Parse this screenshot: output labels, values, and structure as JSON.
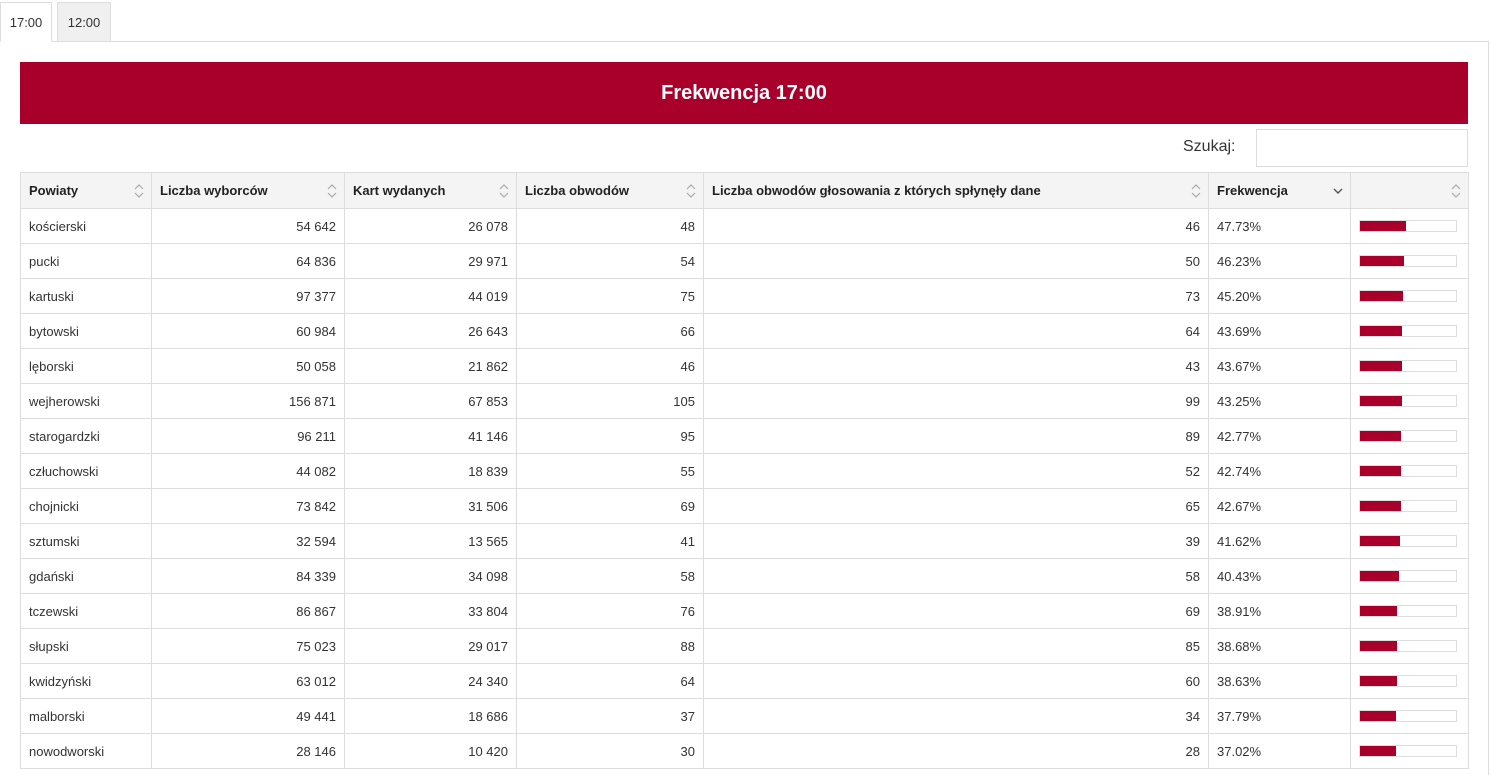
{
  "tabs": [
    {
      "label": "17:00",
      "active": true
    },
    {
      "label": "12:00",
      "active": false
    }
  ],
  "banner": {
    "title": "Frekwencja 17:00"
  },
  "search": {
    "label": "Szukaj:",
    "value": ""
  },
  "colors": {
    "accent": "#a8002b",
    "header_bg": "#f4f4f4",
    "border": "#dddddd"
  },
  "table": {
    "columns": [
      "Powiaty",
      "Liczba wyborców",
      "Kart wydanych",
      "Liczba obwodów",
      "Liczba obwodów głosowania z których spłynęły dane",
      "Frekwencja",
      ""
    ],
    "sorted_column": 5,
    "sort_direction": "desc",
    "rows": [
      {
        "name": "kościerski",
        "voters": "54 642",
        "cards": "26 078",
        "districts": "48",
        "reported": "46",
        "turnout": "47.73%",
        "turnout_pct": 47.73
      },
      {
        "name": "pucki",
        "voters": "64 836",
        "cards": "29 971",
        "districts": "54",
        "reported": "50",
        "turnout": "46.23%",
        "turnout_pct": 46.23
      },
      {
        "name": "kartuski",
        "voters": "97 377",
        "cards": "44 019",
        "districts": "75",
        "reported": "73",
        "turnout": "45.20%",
        "turnout_pct": 45.2
      },
      {
        "name": "bytowski",
        "voters": "60 984",
        "cards": "26 643",
        "districts": "66",
        "reported": "64",
        "turnout": "43.69%",
        "turnout_pct": 43.69
      },
      {
        "name": "lęborski",
        "voters": "50 058",
        "cards": "21 862",
        "districts": "46",
        "reported": "43",
        "turnout": "43.67%",
        "turnout_pct": 43.67
      },
      {
        "name": "wejherowski",
        "voters": "156 871",
        "cards": "67 853",
        "districts": "105",
        "reported": "99",
        "turnout": "43.25%",
        "turnout_pct": 43.25
      },
      {
        "name": "starogardzki",
        "voters": "96 211",
        "cards": "41 146",
        "districts": "95",
        "reported": "89",
        "turnout": "42.77%",
        "turnout_pct": 42.77
      },
      {
        "name": "człuchowski",
        "voters": "44 082",
        "cards": "18 839",
        "districts": "55",
        "reported": "52",
        "turnout": "42.74%",
        "turnout_pct": 42.74
      },
      {
        "name": "chojnicki",
        "voters": "73 842",
        "cards": "31 506",
        "districts": "69",
        "reported": "65",
        "turnout": "42.67%",
        "turnout_pct": 42.67
      },
      {
        "name": "sztumski",
        "voters": "32 594",
        "cards": "13 565",
        "districts": "41",
        "reported": "39",
        "turnout": "41.62%",
        "turnout_pct": 41.62
      },
      {
        "name": "gdański",
        "voters": "84 339",
        "cards": "34 098",
        "districts": "58",
        "reported": "58",
        "turnout": "40.43%",
        "turnout_pct": 40.43
      },
      {
        "name": "tczewski",
        "voters": "86 867",
        "cards": "33 804",
        "districts": "76",
        "reported": "69",
        "turnout": "38.91%",
        "turnout_pct": 38.91
      },
      {
        "name": "słupski",
        "voters": "75 023",
        "cards": "29 017",
        "districts": "88",
        "reported": "85",
        "turnout": "38.68%",
        "turnout_pct": 38.68
      },
      {
        "name": "kwidzyński",
        "voters": "63 012",
        "cards": "24 340",
        "districts": "64",
        "reported": "60",
        "turnout": "38.63%",
        "turnout_pct": 38.63
      },
      {
        "name": "malborski",
        "voters": "49 441",
        "cards": "18 686",
        "districts": "37",
        "reported": "34",
        "turnout": "37.79%",
        "turnout_pct": 37.79
      },
      {
        "name": "nowodworski",
        "voters": "28 146",
        "cards": "10 420",
        "districts": "30",
        "reported": "28",
        "turnout": "37.02%",
        "turnout_pct": 37.02
      }
    ]
  }
}
